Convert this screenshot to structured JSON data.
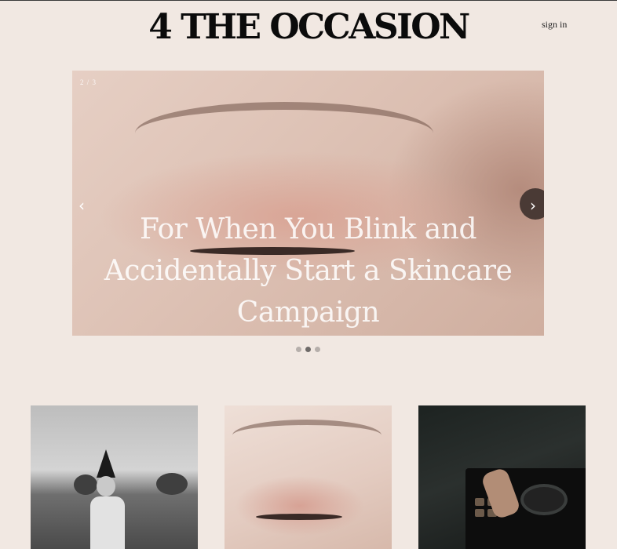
{
  "header": {
    "logo": "4 THE OCCASION",
    "sign_in": "sign in"
  },
  "hero": {
    "counter": "2 / 3",
    "title": "For When You Blink and Accidentally Start a Skincare Campaign",
    "prev_glyph": "‹",
    "next_glyph": "›",
    "slide_count": 3,
    "active_slide": 2
  },
  "cards": [
    {
      "image": "witch-hat-portrait-photo"
    },
    {
      "image": "eye-makeup-closeup-photo"
    },
    {
      "image": "dj-controller-hands-photo"
    }
  ]
}
